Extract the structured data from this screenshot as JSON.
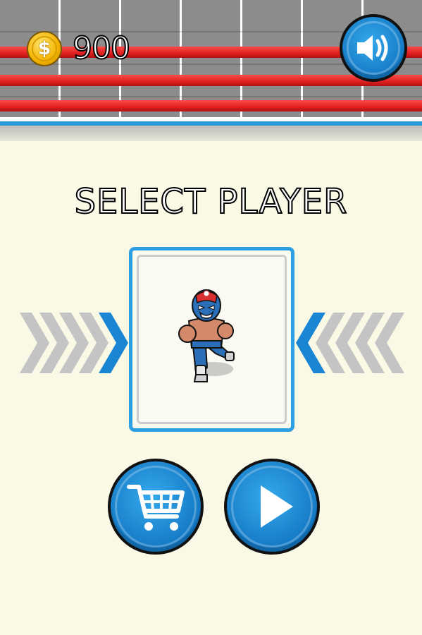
{
  "hud": {
    "coins": "900",
    "coin_icon": "dollar-coin-icon",
    "coin_symbol": "$",
    "sound_icon": "speaker-icon"
  },
  "screen": {
    "title": "SELECT PLAYER"
  },
  "selector": {
    "character": "masked-luchador-wrestler",
    "prev_icon": "chevron-right-arrows-icon",
    "next_icon": "chevron-left-arrows-icon"
  },
  "actions": {
    "shop_icon": "shopping-cart-icon",
    "play_icon": "play-icon"
  },
  "colors": {
    "accent": "#1a86d3",
    "rope": "#e02020",
    "background": "#f9f9e6",
    "chevron_gray": "#c4c4c4"
  }
}
